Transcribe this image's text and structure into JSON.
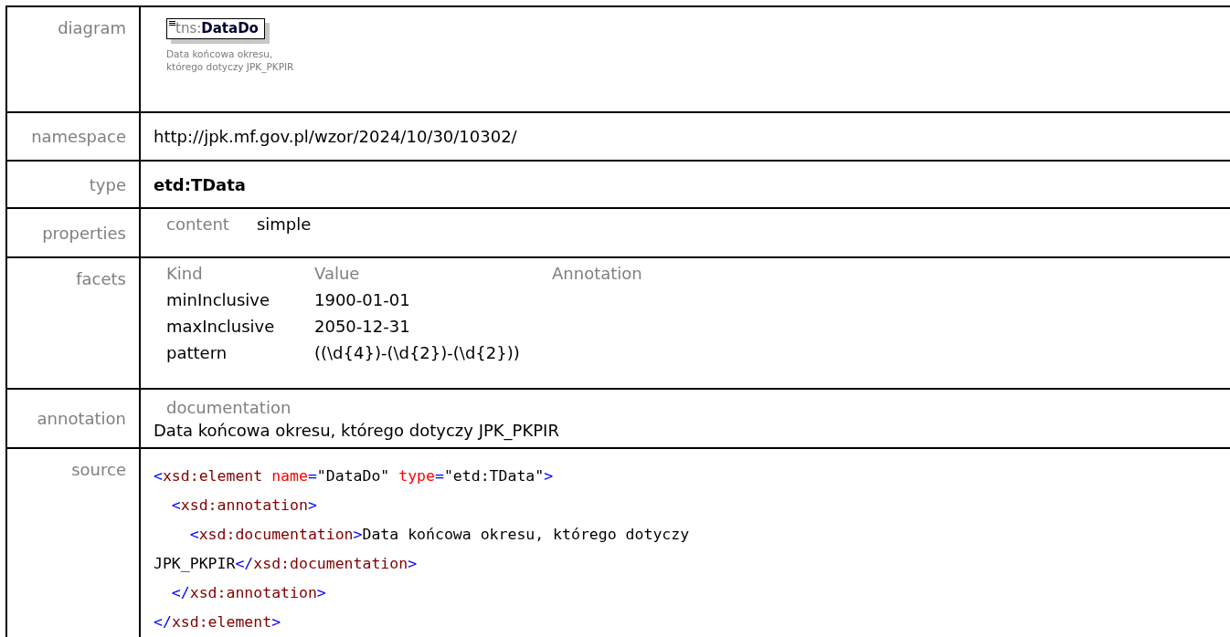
{
  "rows": [
    {
      "label": "diagram",
      "kind": "diagram",
      "prefix": "tns:",
      "name": "DataDo",
      "caption": [
        "Data końcowa okresu,",
        "którego dotyczy JPK_PKPIR"
      ]
    },
    {
      "label": "namespace",
      "kind": "plain",
      "value": "http://jpk.mf.gov.pl/wzor/2024/10/30/10302/"
    },
    {
      "label": "type",
      "kind": "bold",
      "value": "etd:TData"
    },
    {
      "label": "properties",
      "kind": "properties",
      "items": [
        {
          "key": "content",
          "value": "simple"
        }
      ]
    },
    {
      "label": "facets",
      "kind": "facets",
      "columns": [
        "Kind",
        "Value",
        "Annotation"
      ],
      "items": [
        {
          "kind": "minInclusive",
          "value": "1900-01-01"
        },
        {
          "kind": "maxInclusive",
          "value": "2050-12-31"
        },
        {
          "kind": "pattern",
          "value": "((\\d{4})-(\\d{2})-(\\d{2}))"
        }
      ]
    },
    {
      "label": "annotation",
      "kind": "annotation",
      "heading": "documentation",
      "value": "Data końcowa okresu, którego dotyczy JPK_PKPIR"
    },
    {
      "label": "source",
      "kind": "source",
      "lines": [
        [
          {
            "t": "<",
            "kind": "punct"
          },
          {
            "t": "xsd:element",
            "kind": "tag"
          },
          {
            "t": " name",
            "kind": "attr"
          },
          {
            "t": "=",
            "kind": "punct"
          },
          {
            "t": "\"DataDo\"",
            "kind": "text"
          },
          {
            "t": " type",
            "kind": "attr"
          },
          {
            "t": "=",
            "kind": "punct"
          },
          {
            "t": "\"etd:TData\"",
            "kind": "text"
          },
          {
            "t": ">",
            "kind": "punct"
          }
        ],
        [
          {
            "t": "  <",
            "kind": "punct"
          },
          {
            "t": "xsd:annotation",
            "kind": "tag"
          },
          {
            "t": ">",
            "kind": "punct"
          }
        ],
        [
          {
            "t": "    <",
            "kind": "punct"
          },
          {
            "t": "xsd:documentation",
            "kind": "tag"
          },
          {
            "t": ">",
            "kind": "punct"
          },
          {
            "t": "Data końcowa okresu, którego dotyczy",
            "kind": "text"
          }
        ],
        [
          {
            "t": "JPK_PKPIR",
            "kind": "text"
          },
          {
            "t": "</",
            "kind": "punct"
          },
          {
            "t": "xsd:documentation",
            "kind": "tag"
          },
          {
            "t": ">",
            "kind": "punct"
          }
        ],
        [
          {
            "t": "  </",
            "kind": "punct"
          },
          {
            "t": "xsd:annotation",
            "kind": "tag"
          },
          {
            "t": ">",
            "kind": "punct"
          }
        ],
        [
          {
            "t": "</",
            "kind": "punct"
          },
          {
            "t": "xsd:element",
            "kind": "tag"
          },
          {
            "t": ">",
            "kind": "punct"
          }
        ]
      ]
    }
  ]
}
